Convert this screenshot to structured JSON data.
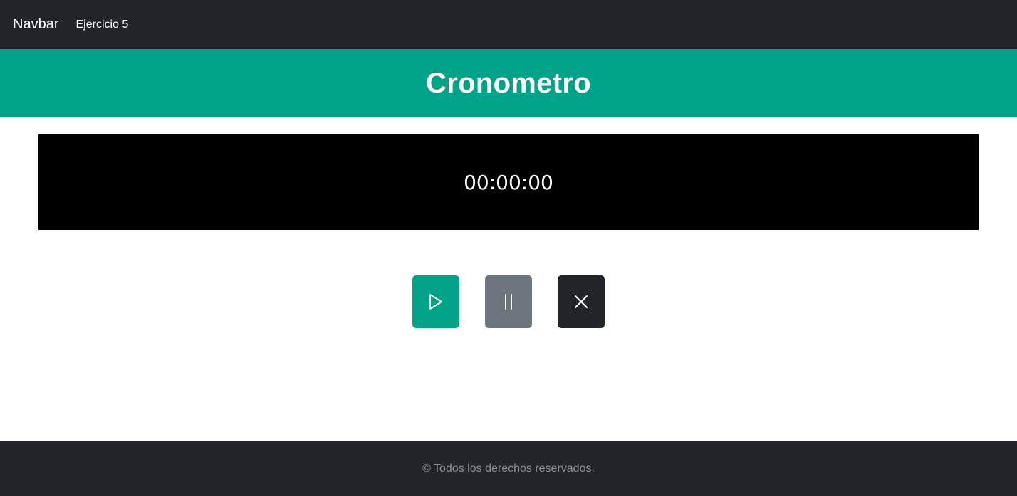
{
  "navbar": {
    "brand": "Navbar",
    "links": [
      {
        "label": "Ejercicio 5"
      }
    ]
  },
  "header": {
    "title": "Cronometro"
  },
  "timer": {
    "display": "00:00:00"
  },
  "controls": [
    {
      "name": "play",
      "icon": "play-icon",
      "color": "#00a388"
    },
    {
      "name": "pause",
      "icon": "pause-icon",
      "color": "#6c757d"
    },
    {
      "name": "reset",
      "icon": "close-icon",
      "color": "#212529"
    }
  ],
  "footer": {
    "text": "© Todos los derechos reservados."
  },
  "colors": {
    "navbar_bg": "#212529",
    "accent": "#00a388",
    "timer_bg": "#000000"
  }
}
